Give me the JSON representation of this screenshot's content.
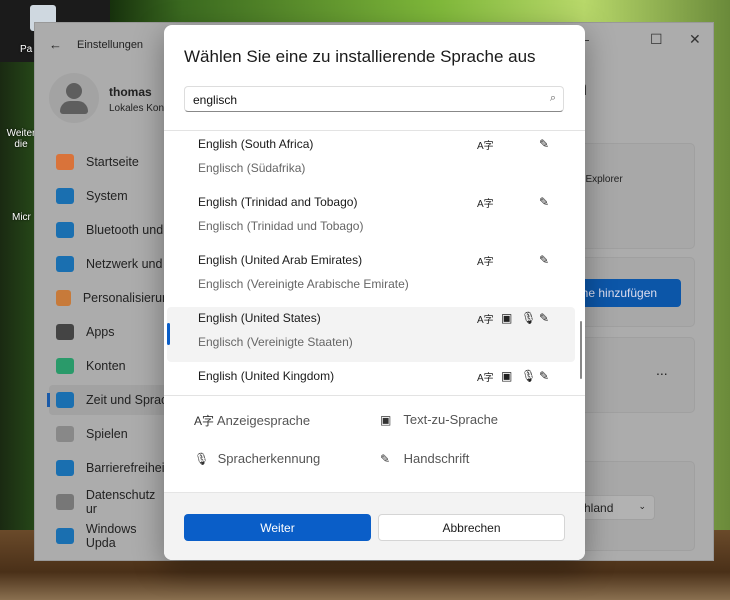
{
  "desktop": {
    "icons": [
      "Pa",
      "Weiter die",
      "Micr"
    ]
  },
  "settings": {
    "title": "Einstellungen",
    "user": {
      "name": "thomas",
      "account": "Lokales Kon"
    },
    "nav": [
      {
        "label": "Startseite",
        "color": "#d9733a"
      },
      {
        "label": "System",
        "color": "#1a6fb0"
      },
      {
        "label": "Bluetooth und",
        "color": "#1a6fb0"
      },
      {
        "label": "Netzwerk und",
        "color": "#1a6fb0"
      },
      {
        "label": "Personalisierun",
        "color": "#c77a3a"
      },
      {
        "label": "Apps",
        "color": "#444"
      },
      {
        "label": "Konten",
        "color": "#2a9a6a"
      },
      {
        "label": "Zeit und Sprac",
        "color": "#1a6fb0"
      },
      {
        "label": "Spielen",
        "color": "#888"
      },
      {
        "label": "Barrierefreiheit",
        "color": "#1a6fb0"
      },
      {
        "label": "Datenschutz ur",
        "color": "#777"
      },
      {
        "label": "Windows Upda",
        "color": "#1a6fb0"
      }
    ],
    "content": {
      "heading_partial": "n",
      "explorer_text": "atei-Explorer",
      "add_button": "ache hinzufügen",
      "more": "...",
      "region_select": "chland"
    }
  },
  "dialog": {
    "title": "Wählen Sie eine zu installierende Sprache aus",
    "search": {
      "value": "englisch"
    },
    "languages": [
      {
        "name": "English (South Africa)",
        "native": "Englisch (Südafrika)",
        "features": [
          "display",
          "handwriting"
        ]
      },
      {
        "name": "English (Trinidad and Tobago)",
        "native": "Englisch (Trinidad und Tobago)",
        "features": [
          "display",
          "handwriting"
        ]
      },
      {
        "name": "English (United Arab Emirates)",
        "native": "Englisch (Vereinigte Arabische Emirate)",
        "features": [
          "display",
          "handwriting"
        ]
      },
      {
        "name": "English (United States)",
        "native": "Englisch (Vereinigte Staaten)",
        "features": [
          "display",
          "tts",
          "speech",
          "handwriting"
        ],
        "selected": true
      },
      {
        "name": "English (United Kingdom)",
        "native": "Englisch (Vereinigtes Königreich)",
        "features": [
          "display",
          "tts",
          "speech",
          "handwriting"
        ]
      }
    ],
    "legend": {
      "display": "Anzeigesprache",
      "tts": "Text-zu-Sprache",
      "speech": "Spracherkennung",
      "handwriting": "Handschrift"
    },
    "buttons": {
      "next": "Weiter",
      "cancel": "Abbrechen"
    },
    "accent": "#0a5ec8"
  }
}
